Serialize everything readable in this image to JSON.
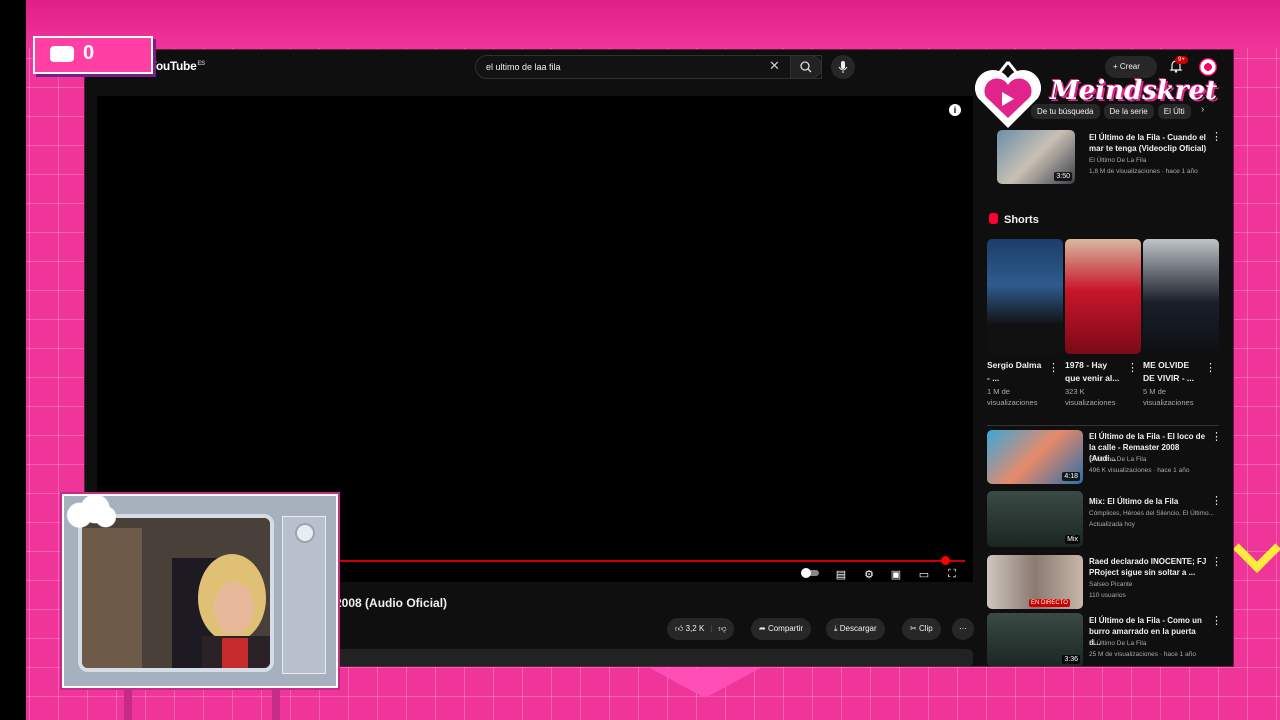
{
  "counter": {
    "value": "0"
  },
  "brand": {
    "name": "Meindskret"
  },
  "youtube": {
    "logo": "YouTube",
    "logo_region": "ES",
    "search_value": "el ultimo de laa fila",
    "create_label": "Crear",
    "notification_count": "9+",
    "video": {
      "title_visible": "2008 (Audio Oficial)",
      "likes": "3,2 K",
      "share_label": "Compartir",
      "download_label": "Descargar",
      "clip_label": "Clip"
    },
    "chips": [
      "De tu búsqueda",
      "De la serie",
      "El Últi"
    ],
    "related_top": {
      "title": "El Último de la Fila - Cuando el mar te tenga (Videoclip Oficial)",
      "channel": "El Último De La Fila",
      "meta": "1,8 M de visualizaciones · hace 1 año",
      "duration": "3:50"
    },
    "shorts": {
      "heading": "Shorts",
      "items": [
        {
          "title": "Sergio Dalma - ...",
          "views": "1 M de visualizaciones"
        },
        {
          "title": "1978 - Hay que venir al...",
          "views": "323 K visualizaciones"
        },
        {
          "title": "ME OLVIDE DE VIVIR - ...",
          "views": "5 M de visualizaciones"
        }
      ]
    },
    "related": [
      {
        "title": "El Último de la Fila - El loco de la calle - Remaster 2008 (Audi...",
        "channel": "El Último De La Fila",
        "meta": "496 K visualizaciones · hace 1 año",
        "duration": "4:18"
      },
      {
        "title": "Mix: El Último de la Fila",
        "channel": "Cómplices, Héroes del Silencio, El Último...",
        "meta": "Actualizada hoy",
        "duration": "Mix"
      },
      {
        "title": "Raed declarado INOCENTE; FJ PRoject sigue sin soltar a ...",
        "channel": "Salseo Picante",
        "meta": "110 usuarios",
        "duration": "EN DIRECTO"
      },
      {
        "title": "El Último de la Fila - Como un burro amarrado en la puerta d...",
        "channel": "El Último De La Fila",
        "meta": "25 M de visualizaciones · hace 1 año",
        "duration": "3:36"
      }
    ]
  },
  "colors": {
    "background": "#f0359a",
    "accent": "#ffeb3b",
    "yt_red": "#cc0000"
  }
}
